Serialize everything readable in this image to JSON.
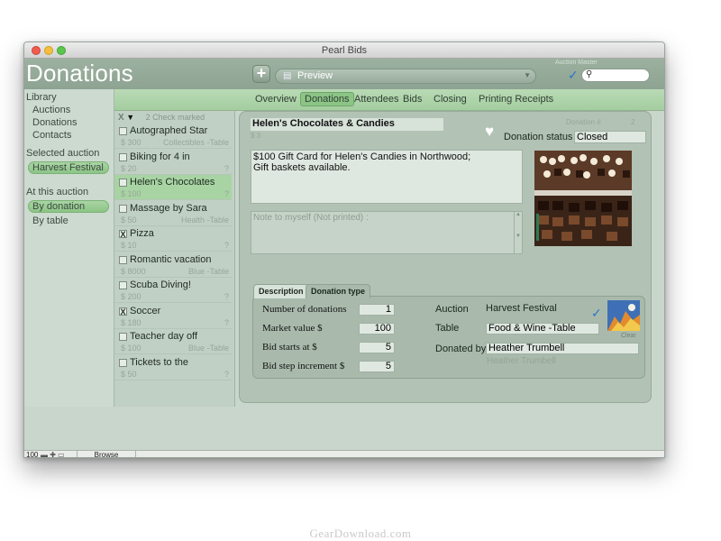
{
  "window": {
    "title": "Pearl Bids"
  },
  "header": {
    "title": "Donations",
    "add_label": "+",
    "preview_label": "Preview",
    "auction_master_label": "Auction Master"
  },
  "sidebar": {
    "library_heading": "Library",
    "library_items": [
      "Auctions",
      "Donations",
      "Contacts"
    ],
    "selected_auction_heading": "Selected auction",
    "selected_auction": "Harvest Festival",
    "at_this_auction_heading": "At this auction",
    "view_items": [
      "By donation",
      "By table"
    ]
  },
  "tabs": [
    "Overview",
    "Donations",
    "Attendees",
    "Bids",
    "Closing",
    "Printing Receipts"
  ],
  "list": {
    "header_check": "X",
    "header_label": "2 Check marked",
    "rows": [
      {
        "checked": "",
        "title": "Autographed Star",
        "value": "$ 300",
        "category": "Collectibles -Table"
      },
      {
        "checked": "",
        "title": "Biking for 4 in",
        "value": "$ 20",
        "category": "?"
      },
      {
        "checked": "",
        "title": "Helen's Chocolates",
        "value": "$ 100",
        "category": "?"
      },
      {
        "checked": "",
        "title": "Massage by Sara",
        "value": "$ 50",
        "category": "Health -Table"
      },
      {
        "checked": "X",
        "title": "Pizza",
        "value": "$ 10",
        "category": "?"
      },
      {
        "checked": "",
        "title": "Romantic vacation",
        "value": "$ 8000",
        "category": "Blue -Table"
      },
      {
        "checked": "",
        "title": "Scuba Diving!",
        "value": "$ 200",
        "category": "?"
      },
      {
        "checked": "X",
        "title": "Soccer",
        "value": "$ 180",
        "category": "?"
      },
      {
        "checked": "",
        "title": "Teacher day off",
        "value": "$ 100",
        "category": "Blue -Table"
      },
      {
        "checked": "",
        "title": "Tickets to the",
        "value": "$ 50",
        "category": "?"
      }
    ]
  },
  "detail": {
    "name": "Helen's Chocolates & Candies",
    "dollar_hint": "$ 3",
    "donation_no_label": "Donation #",
    "donation_no_value": "2",
    "status_label": "Donation status",
    "status_value": "Closed",
    "description_line1": "$100 Gift Card for Helen's Candies in Northwood;",
    "description_line2": "Gift baskets available.",
    "note_placeholder": "Note to myself  (Not printed) :",
    "tabs": [
      "Description",
      "Donation type"
    ],
    "fields": {
      "num_donations_label": "Number of donations",
      "num_donations_value": "1",
      "market_value_label": "Market value $",
      "market_value_value": "100",
      "bid_starts_label": "Bid starts at $",
      "bid_starts_value": "5",
      "bid_step_label": "Bid step increment $",
      "bid_step_value": "5"
    },
    "right": {
      "auction_label": "Auction",
      "auction_value": "Harvest Festival",
      "table_label": "Table",
      "table_value": "Food & Wine -Table",
      "donated_by_label": "Donated by",
      "donated_by_value": "Heather Trumbell",
      "donated_by_ghost": "Heather Trumbell",
      "clear_label": "Clear"
    }
  },
  "statusbar": {
    "zoom": "100",
    "mode": "Browse"
  },
  "watermark": "GearDownload.com",
  "colors": {
    "accent_green": "#8cc486",
    "header_green": "#9cb19f",
    "check_blue": "#2a74c9"
  }
}
